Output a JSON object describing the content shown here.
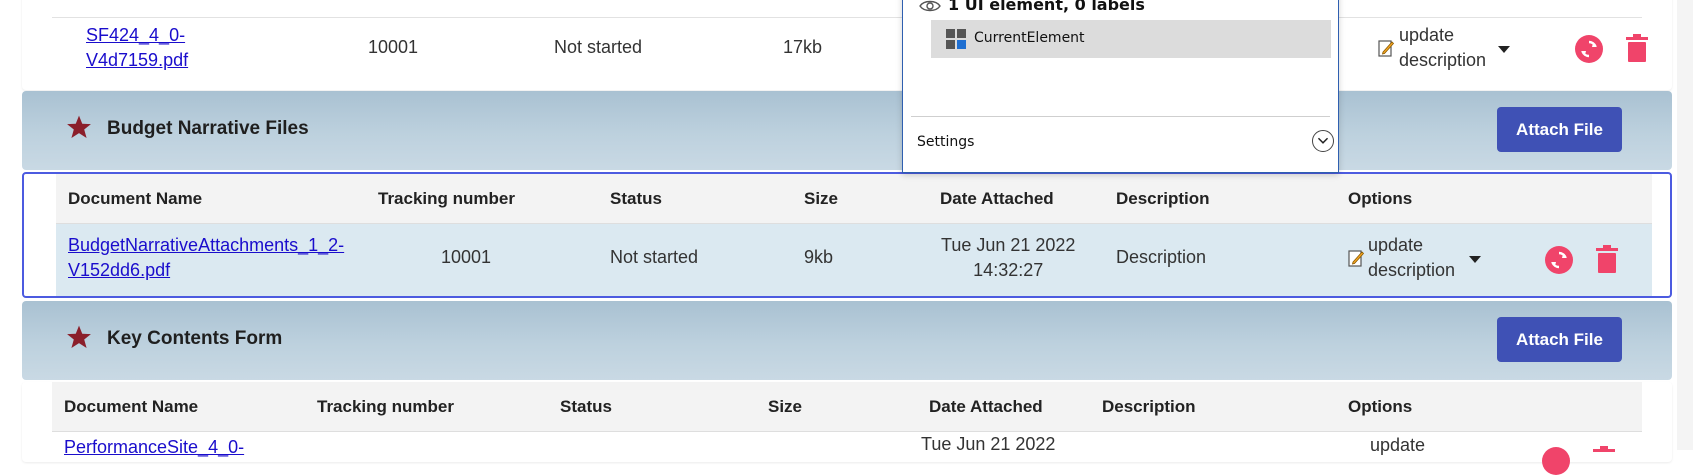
{
  "top_row": {
    "file_link": "SF424_4_0-V4d7159.pdf",
    "file_line1": "SF424_4_0-",
    "file_line2": "V4d7159.pdf",
    "tracking": "10001",
    "status": "Not started",
    "size": "17kb",
    "update_line1": "update",
    "update_line2": "description"
  },
  "sections": {
    "budget": {
      "title": "Budget Narrative Files",
      "attach_label": "Attach File",
      "columns": [
        "Document Name",
        "Tracking number",
        "Status",
        "Size",
        "Date Attached",
        "Description",
        "Options"
      ],
      "row": {
        "file_line1": "BudgetNarrativeAttachments_1_2-",
        "file_line2": "V152dd6.pdf",
        "tracking": "10001",
        "status": "Not started",
        "size": "9kb",
        "date_line1": "Tue Jun 21 2022",
        "date_line2": "14:32:27",
        "description": "Description",
        "update_line1": "update",
        "update_line2": "description"
      }
    },
    "key": {
      "title": "Key Contents Form",
      "attach_label": "Attach File",
      "columns": [
        "Document Name",
        "Tracking number",
        "Status",
        "Size",
        "Date Attached",
        "Description",
        "Options"
      ],
      "row": {
        "file_line1": "PerformanceSite_4_0-",
        "date_line1": "Tue Jun 21 2022",
        "update_line1": "update"
      }
    }
  },
  "popup": {
    "header": "1 UI element, 0 labels",
    "item": "CurrentElement",
    "settings": "Settings"
  },
  "colors": {
    "accent_button": "#3f51b5",
    "danger": "#f0446a",
    "link": "#1a0dcc",
    "star": "#8b1f2b",
    "selected_border": "#4c5be0"
  }
}
